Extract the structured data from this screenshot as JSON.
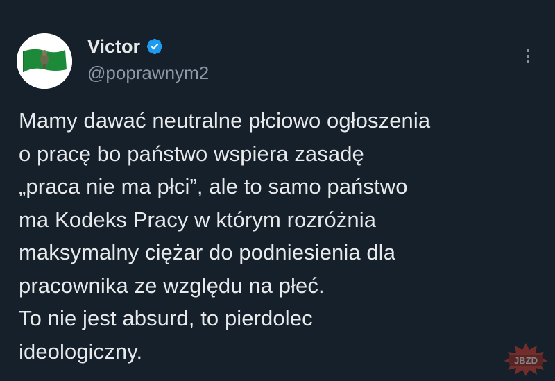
{
  "author": {
    "display_name": "Victor",
    "handle": "@poprawnym2",
    "verified": true,
    "avatar_colors": {
      "background": "#ffffff",
      "flag": "#1d8a3a",
      "emblem": "#6b6b4e"
    }
  },
  "tweet": {
    "lines": [
      "Mamy dawać neutralne płciowo ogłoszenia",
      "o pracę bo państwo wspiera zasadę",
      "„praca nie ma płci”, ale to samo państwo",
      "ma Kodeks Pracy w którym rozróżnia",
      "maksymalny ciężar do podniesienia dla",
      "pracownika ze względu na płeć.",
      "To nie jest absurd, to pierdolec",
      "ideologiczny."
    ]
  },
  "icons": {
    "verified": "verified-badge-icon",
    "more": "more-options-icon"
  },
  "watermark": {
    "text": "JBZD",
    "color": "#c0392b"
  },
  "colors": {
    "background": "#15202b",
    "text": "#e7e9ea",
    "muted": "#8b98a5",
    "accent": "#1d9bf0"
  }
}
